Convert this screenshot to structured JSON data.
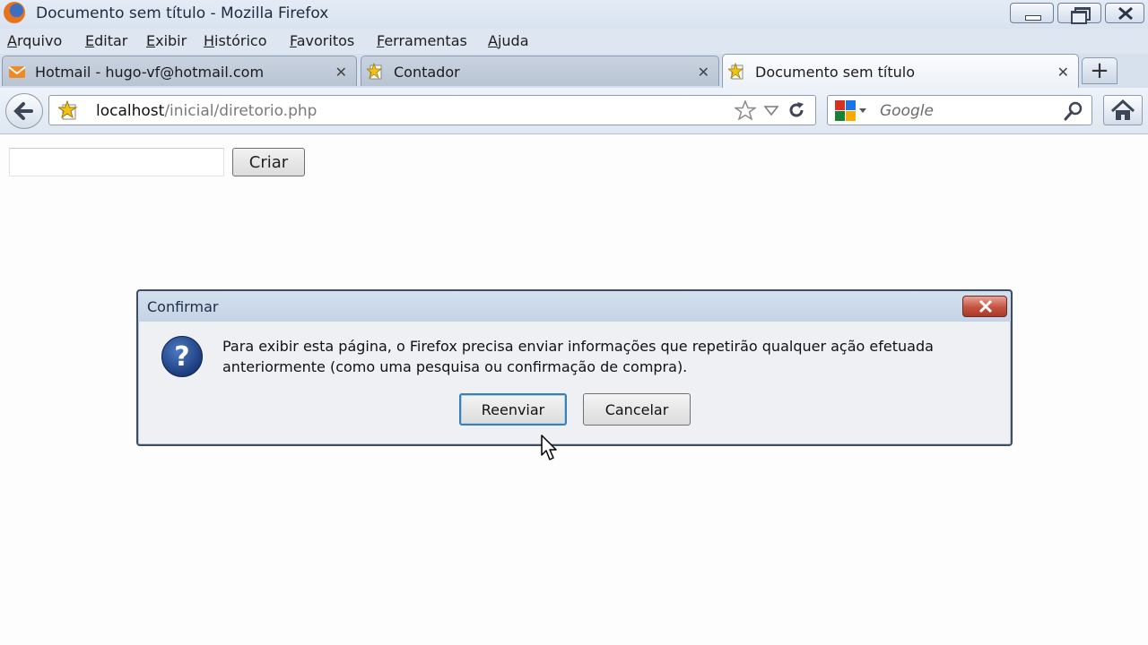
{
  "window": {
    "title": "Documento sem título - Mozilla Firefox"
  },
  "menu": [
    "Arquivo",
    "Editar",
    "Exibir",
    "Histórico",
    "Favoritos",
    "Ferramentas",
    "Ajuda"
  ],
  "tabs": [
    {
      "label": "Hotmail - hugo-vf@hotmail.com",
      "icon": "hotmail-icon",
      "active": false
    },
    {
      "label": "Contador",
      "icon": "star-page-icon",
      "active": false
    },
    {
      "label": "Documento sem título",
      "icon": "star-page-icon",
      "active": true
    }
  ],
  "navbar": {
    "url_host": "localhost",
    "url_path": "/inicial/diretorio.php",
    "search_placeholder": "Google"
  },
  "page": {
    "input_value": "",
    "button_label": "Criar"
  },
  "dialog": {
    "title": "Confirmar",
    "message": "Para exibir esta página, o Firefox precisa enviar informações que repetirão qualquer ação efetuada anteriormente (como uma pesquisa ou confirmação de compra).",
    "ok_label": "Reenviar",
    "cancel_label": "Cancelar",
    "icon": "question-icon"
  },
  "colors": {
    "titlebar": "#dde6f1",
    "dialog_close": "#c4523f",
    "question_icon": "#1c3d7e"
  }
}
